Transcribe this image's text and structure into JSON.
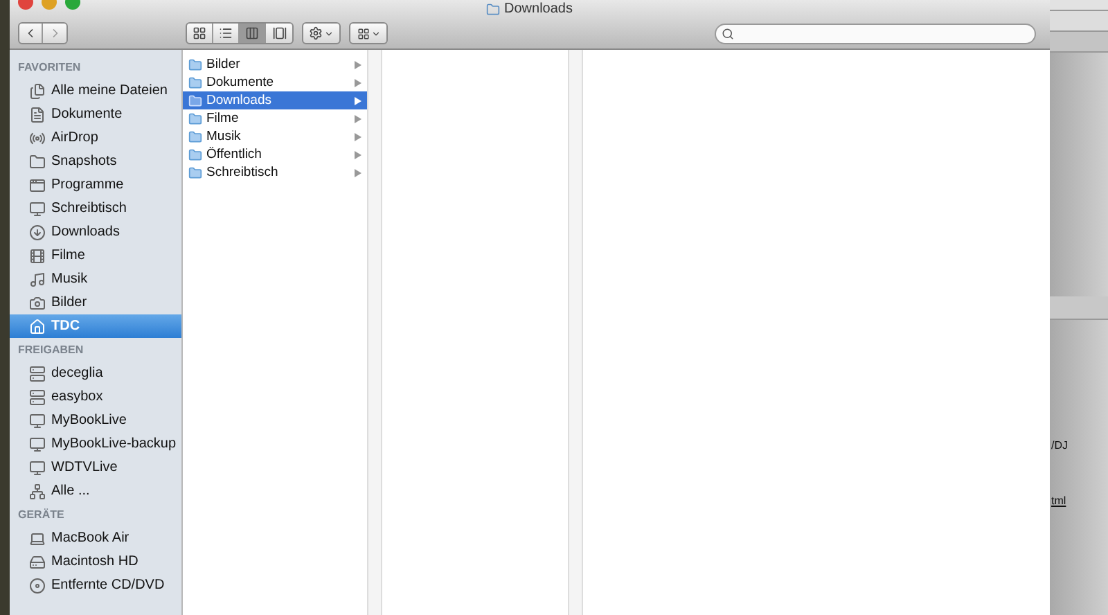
{
  "window": {
    "title": "Downloads"
  },
  "toolbar": {
    "view_modes": [
      {
        "kind": "icons",
        "selected": false
      },
      {
        "kind": "list",
        "selected": false
      },
      {
        "kind": "columns",
        "selected": true
      },
      {
        "kind": "coverflow",
        "selected": false
      }
    ]
  },
  "sidebar": {
    "sections": [
      {
        "heading": "FAVORITEN",
        "items": [
          {
            "label": "Alle meine Dateien",
            "kind": "files",
            "selected": false
          },
          {
            "label": "Dokumente",
            "kind": "documents",
            "selected": false
          },
          {
            "label": "AirDrop",
            "kind": "airdrop",
            "selected": false
          },
          {
            "label": "Snapshots",
            "kind": "folder",
            "selected": false
          },
          {
            "label": "Programme",
            "kind": "apps",
            "selected": false
          },
          {
            "label": "Schreibtisch",
            "kind": "desktop",
            "selected": false
          },
          {
            "label": "Downloads",
            "kind": "downloads",
            "selected": false
          },
          {
            "label": "Filme",
            "kind": "movies",
            "selected": false
          },
          {
            "label": "Musik",
            "kind": "music",
            "selected": false
          },
          {
            "label": "Bilder",
            "kind": "pictures",
            "selected": false
          },
          {
            "label": "TDC",
            "kind": "home",
            "selected": true
          }
        ]
      },
      {
        "heading": "FREIGABEN",
        "items": [
          {
            "label": "deceglia",
            "kind": "server",
            "selected": false
          },
          {
            "label": "easybox",
            "kind": "server",
            "selected": false
          },
          {
            "label": "MyBookLive",
            "kind": "display",
            "selected": false
          },
          {
            "label": "MyBookLive-backup",
            "kind": "display",
            "selected": false
          },
          {
            "label": "WDTVLive",
            "kind": "display",
            "selected": false
          },
          {
            "label": "Alle ...",
            "kind": "network",
            "selected": false
          }
        ]
      },
      {
        "heading": "GERÄTE",
        "items": [
          {
            "label": "MacBook Air",
            "kind": "laptop",
            "selected": false
          },
          {
            "label": "Macintosh HD",
            "kind": "disk",
            "selected": false
          },
          {
            "label": "Entfernte CD/DVD",
            "kind": "disc",
            "selected": false
          }
        ]
      }
    ]
  },
  "columns": [
    {
      "items": [
        {
          "label": "Bilder",
          "selected": false
        },
        {
          "label": "Dokumente",
          "selected": false
        },
        {
          "label": "Downloads",
          "selected": true
        },
        {
          "label": "Filme",
          "selected": false
        },
        {
          "label": "Musik",
          "selected": false
        },
        {
          "label": "Öffentlich",
          "selected": false
        },
        {
          "label": "Schreibtisch",
          "selected": false
        }
      ]
    }
  ],
  "background_window": {
    "texts": [
      {
        "text": "/DJ",
        "kind": "text"
      },
      {
        "text": "tml",
        "kind": "link"
      }
    ]
  }
}
